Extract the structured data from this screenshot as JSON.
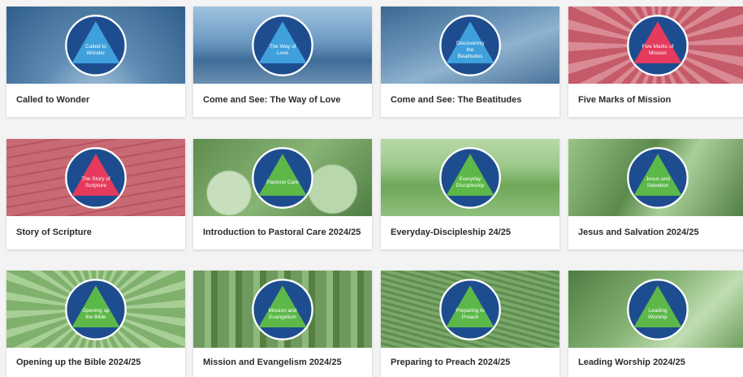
{
  "courses": [
    {
      "title": "Called to Wonder",
      "emblem_text": "Called to Wonder",
      "theme": "blue"
    },
    {
      "title": "Come and See: The Way of Love",
      "emblem_text": "The Way of Love",
      "theme": "blue"
    },
    {
      "title": "Come and See: The Beatitudes",
      "emblem_text": "Discovering the Beatitudes",
      "theme": "blue"
    },
    {
      "title": "Five Marks of Mission",
      "emblem_text": "Five Marks of Mission",
      "theme": "red"
    },
    {
      "title": "Story of Scripture",
      "emblem_text": "The Story of Scripture",
      "theme": "red"
    },
    {
      "title": "Introduction to Pastoral Care 2024/25",
      "emblem_text": "Pastoral Care",
      "theme": "green"
    },
    {
      "title": "Everyday-Discipleship 24/25",
      "emblem_text": "Everyday Discipleship",
      "theme": "green"
    },
    {
      "title": "Jesus and Salvation 2024/25",
      "emblem_text": "Jesus and Salvation",
      "theme": "green"
    },
    {
      "title": "Opening up the Bible 2024/25",
      "emblem_text": "Opening up the Bible",
      "theme": "green"
    },
    {
      "title": "Mission and Evangelism 2024/25",
      "emblem_text": "Mission and Evangelism",
      "theme": "green"
    },
    {
      "title": "Preparing to Preach 2024/25",
      "emblem_text": "Preparing to Preach",
      "theme": "green"
    },
    {
      "title": "Leading Worship 2024/25",
      "emblem_text": "Leading Worship",
      "theme": "green"
    }
  ],
  "colors": {
    "circle": "#1e4d8f",
    "blue_triangle": "#3fa0dc",
    "red_triangle": "#e63a5c",
    "green_triangle": "#5cb848",
    "blue_photo": "#4f7fa8",
    "red_photo": "#c76a74",
    "green_photo": "#7fb06c"
  }
}
